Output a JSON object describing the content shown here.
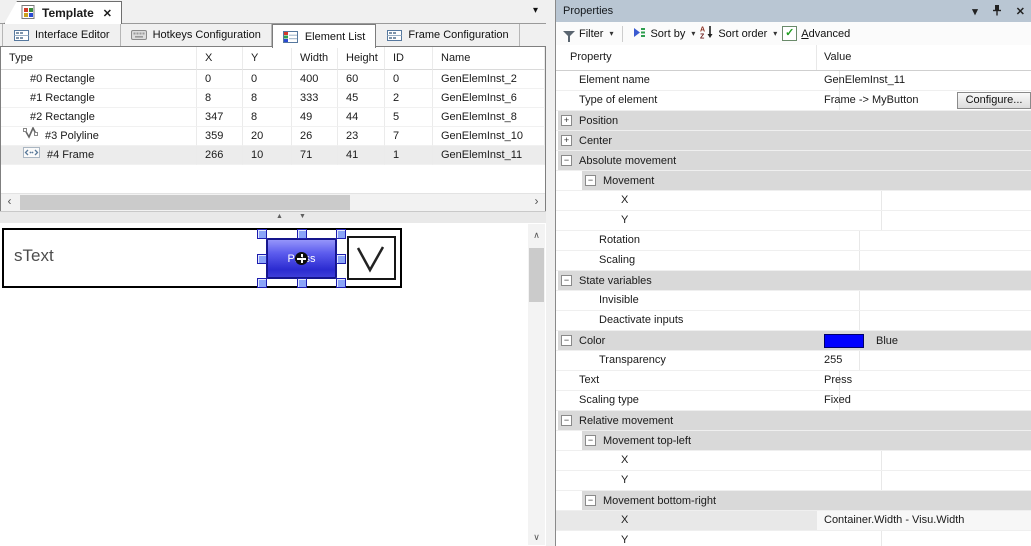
{
  "glyphs": {
    "close": "✕",
    "menu_down": "▾",
    "dropdown": "▾",
    "scroll_left": "‹",
    "scroll_right": "›",
    "scroll_up": "∧",
    "scroll_down": "∨",
    "split_up": "▲",
    "split_down": "▼",
    "check": "✓"
  },
  "colors": {
    "swatch_blue": "#0000ff",
    "element_button_blue": "#2b2bd0",
    "properties_titlebar": "#b9c6d3"
  },
  "left": {
    "doc_tab": {
      "label": "Template"
    },
    "subtabs": [
      {
        "label": "Interface Editor",
        "icon": "form",
        "active": false
      },
      {
        "label": "Hotkeys Configuration",
        "icon": "keyboard",
        "active": false
      },
      {
        "label": "Element List",
        "icon": "list",
        "active": true
      },
      {
        "label": "Frame Configuration",
        "icon": "form",
        "active": false
      }
    ],
    "element_table": {
      "columns": [
        "Type",
        "X",
        "Y",
        "Width",
        "Height",
        "ID",
        "Name"
      ],
      "rows": [
        {
          "icon": "rect",
          "type": "#0 Rectangle",
          "x": "0",
          "y": "0",
          "width": "400",
          "height": "60",
          "id": "0",
          "name": "GenElemInst_2",
          "selected": false
        },
        {
          "icon": "rect",
          "type": "#1 Rectangle",
          "x": "8",
          "y": "8",
          "width": "333",
          "height": "45",
          "id": "2",
          "name": "GenElemInst_6",
          "selected": false
        },
        {
          "icon": "rect",
          "type": "#2 Rectangle",
          "x": "347",
          "y": "8",
          "width": "49",
          "height": "44",
          "id": "5",
          "name": "GenElemInst_8",
          "selected": false
        },
        {
          "icon": "polyline",
          "type": "#3 Polyline",
          "x": "359",
          "y": "20",
          "width": "26",
          "height": "23",
          "id": "7",
          "name": "GenElemInst_10",
          "selected": false
        },
        {
          "icon": "frame",
          "type": "#4 Frame",
          "x": "266",
          "y": "10",
          "width": "71",
          "height": "41",
          "id": "1",
          "name": "GenElemInst_11",
          "selected": true
        }
      ]
    },
    "canvas": {
      "stext": "sText",
      "button_text": "Press"
    }
  },
  "properties": {
    "title": "Properties",
    "toolbar": {
      "filter": "Filter",
      "sort_by": "Sort by",
      "sort_order": "Sort order",
      "advanced_first": "A",
      "advanced_rest": "dvanced",
      "advanced_checked": true
    },
    "columns": [
      "Property",
      "Value"
    ],
    "rows": [
      {
        "kind": "item",
        "label": "Element name",
        "value": "GenElemInst_11",
        "indent": 1
      },
      {
        "kind": "item",
        "label": "Type of element",
        "value": "Frame -> MyButton",
        "indent": 1,
        "button": "Configure..."
      },
      {
        "kind": "group",
        "label": "Position",
        "expand": "+",
        "level": 1
      },
      {
        "kind": "group",
        "label": "Center",
        "expand": "+",
        "level": 1
      },
      {
        "kind": "group",
        "label": "Absolute movement",
        "expand": "−",
        "level": 1
      },
      {
        "kind": "group",
        "label": "Movement",
        "expand": "−",
        "level": 2
      },
      {
        "kind": "item",
        "label": "X",
        "value": "",
        "indent": 3
      },
      {
        "kind": "item",
        "label": "Y",
        "value": "",
        "indent": 3
      },
      {
        "kind": "item",
        "label": "Rotation",
        "value": "",
        "indent": 2
      },
      {
        "kind": "item",
        "label": "Scaling",
        "value": "",
        "indent": 2
      },
      {
        "kind": "group",
        "label": "State variables",
        "expand": "−",
        "level": 1
      },
      {
        "kind": "item",
        "label": "Invisible",
        "value": "",
        "indent": 2
      },
      {
        "kind": "item",
        "label": "Deactivate inputs",
        "value": "",
        "indent": 2
      },
      {
        "kind": "group",
        "label": "Color",
        "expand": "−",
        "level": 1,
        "value": "Blue",
        "swatch": "#0000ff"
      },
      {
        "kind": "item",
        "label": "Transparency",
        "value": "255",
        "indent": 2
      },
      {
        "kind": "item",
        "label": "Text",
        "value": "Press",
        "indent": 1
      },
      {
        "kind": "item",
        "label": "Scaling type",
        "value": "Fixed",
        "indent": 1
      },
      {
        "kind": "group",
        "label": "Relative movement",
        "expand": "−",
        "level": 1
      },
      {
        "kind": "group",
        "label": "Movement top-left",
        "expand": "−",
        "level": 2
      },
      {
        "kind": "item",
        "label": "X",
        "value": "",
        "indent": 3
      },
      {
        "kind": "item",
        "label": "Y",
        "value": "",
        "indent": 3
      },
      {
        "kind": "group",
        "label": "Movement bottom-right",
        "expand": "−",
        "level": 2
      },
      {
        "kind": "item",
        "label": "X",
        "value": "Container.Width - Visu.Width",
        "indent": 3,
        "selected": true
      },
      {
        "kind": "item",
        "label": "Y",
        "value": "",
        "indent": 3
      }
    ]
  }
}
